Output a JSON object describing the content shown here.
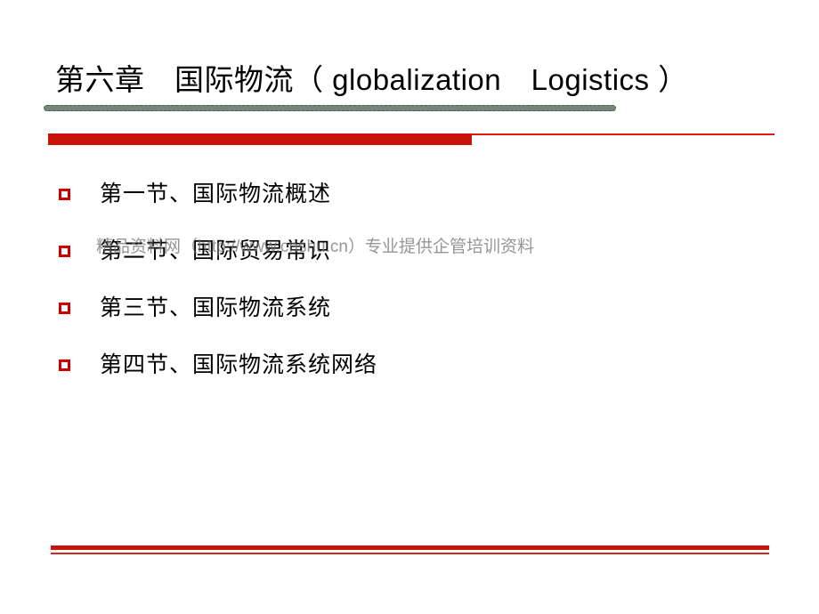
{
  "slide": {
    "title": "第六章　国际物流（ globalization　Logistics ）",
    "bullets": [
      {
        "text": "第一节、国际物流概述"
      },
      {
        "text": "第二节、国际贸易常识"
      },
      {
        "text": "第三节、国际物流系统"
      },
      {
        "text": "第四节、国际物流系统网络"
      }
    ],
    "watermark": "精品资料网（http://www.cnshu.cn）专业提供企管培训资料",
    "colors": {
      "title_text": "#000000",
      "bullet_marker": "#cc0000",
      "accent_red": "#c8140a",
      "accent_red_thin": "#d91a0d",
      "decor_bar_fill": "#808080",
      "decor_bar_border": "#1e7a1e",
      "watermark_text": "#6d6d6d",
      "background": "#ffffff"
    }
  }
}
